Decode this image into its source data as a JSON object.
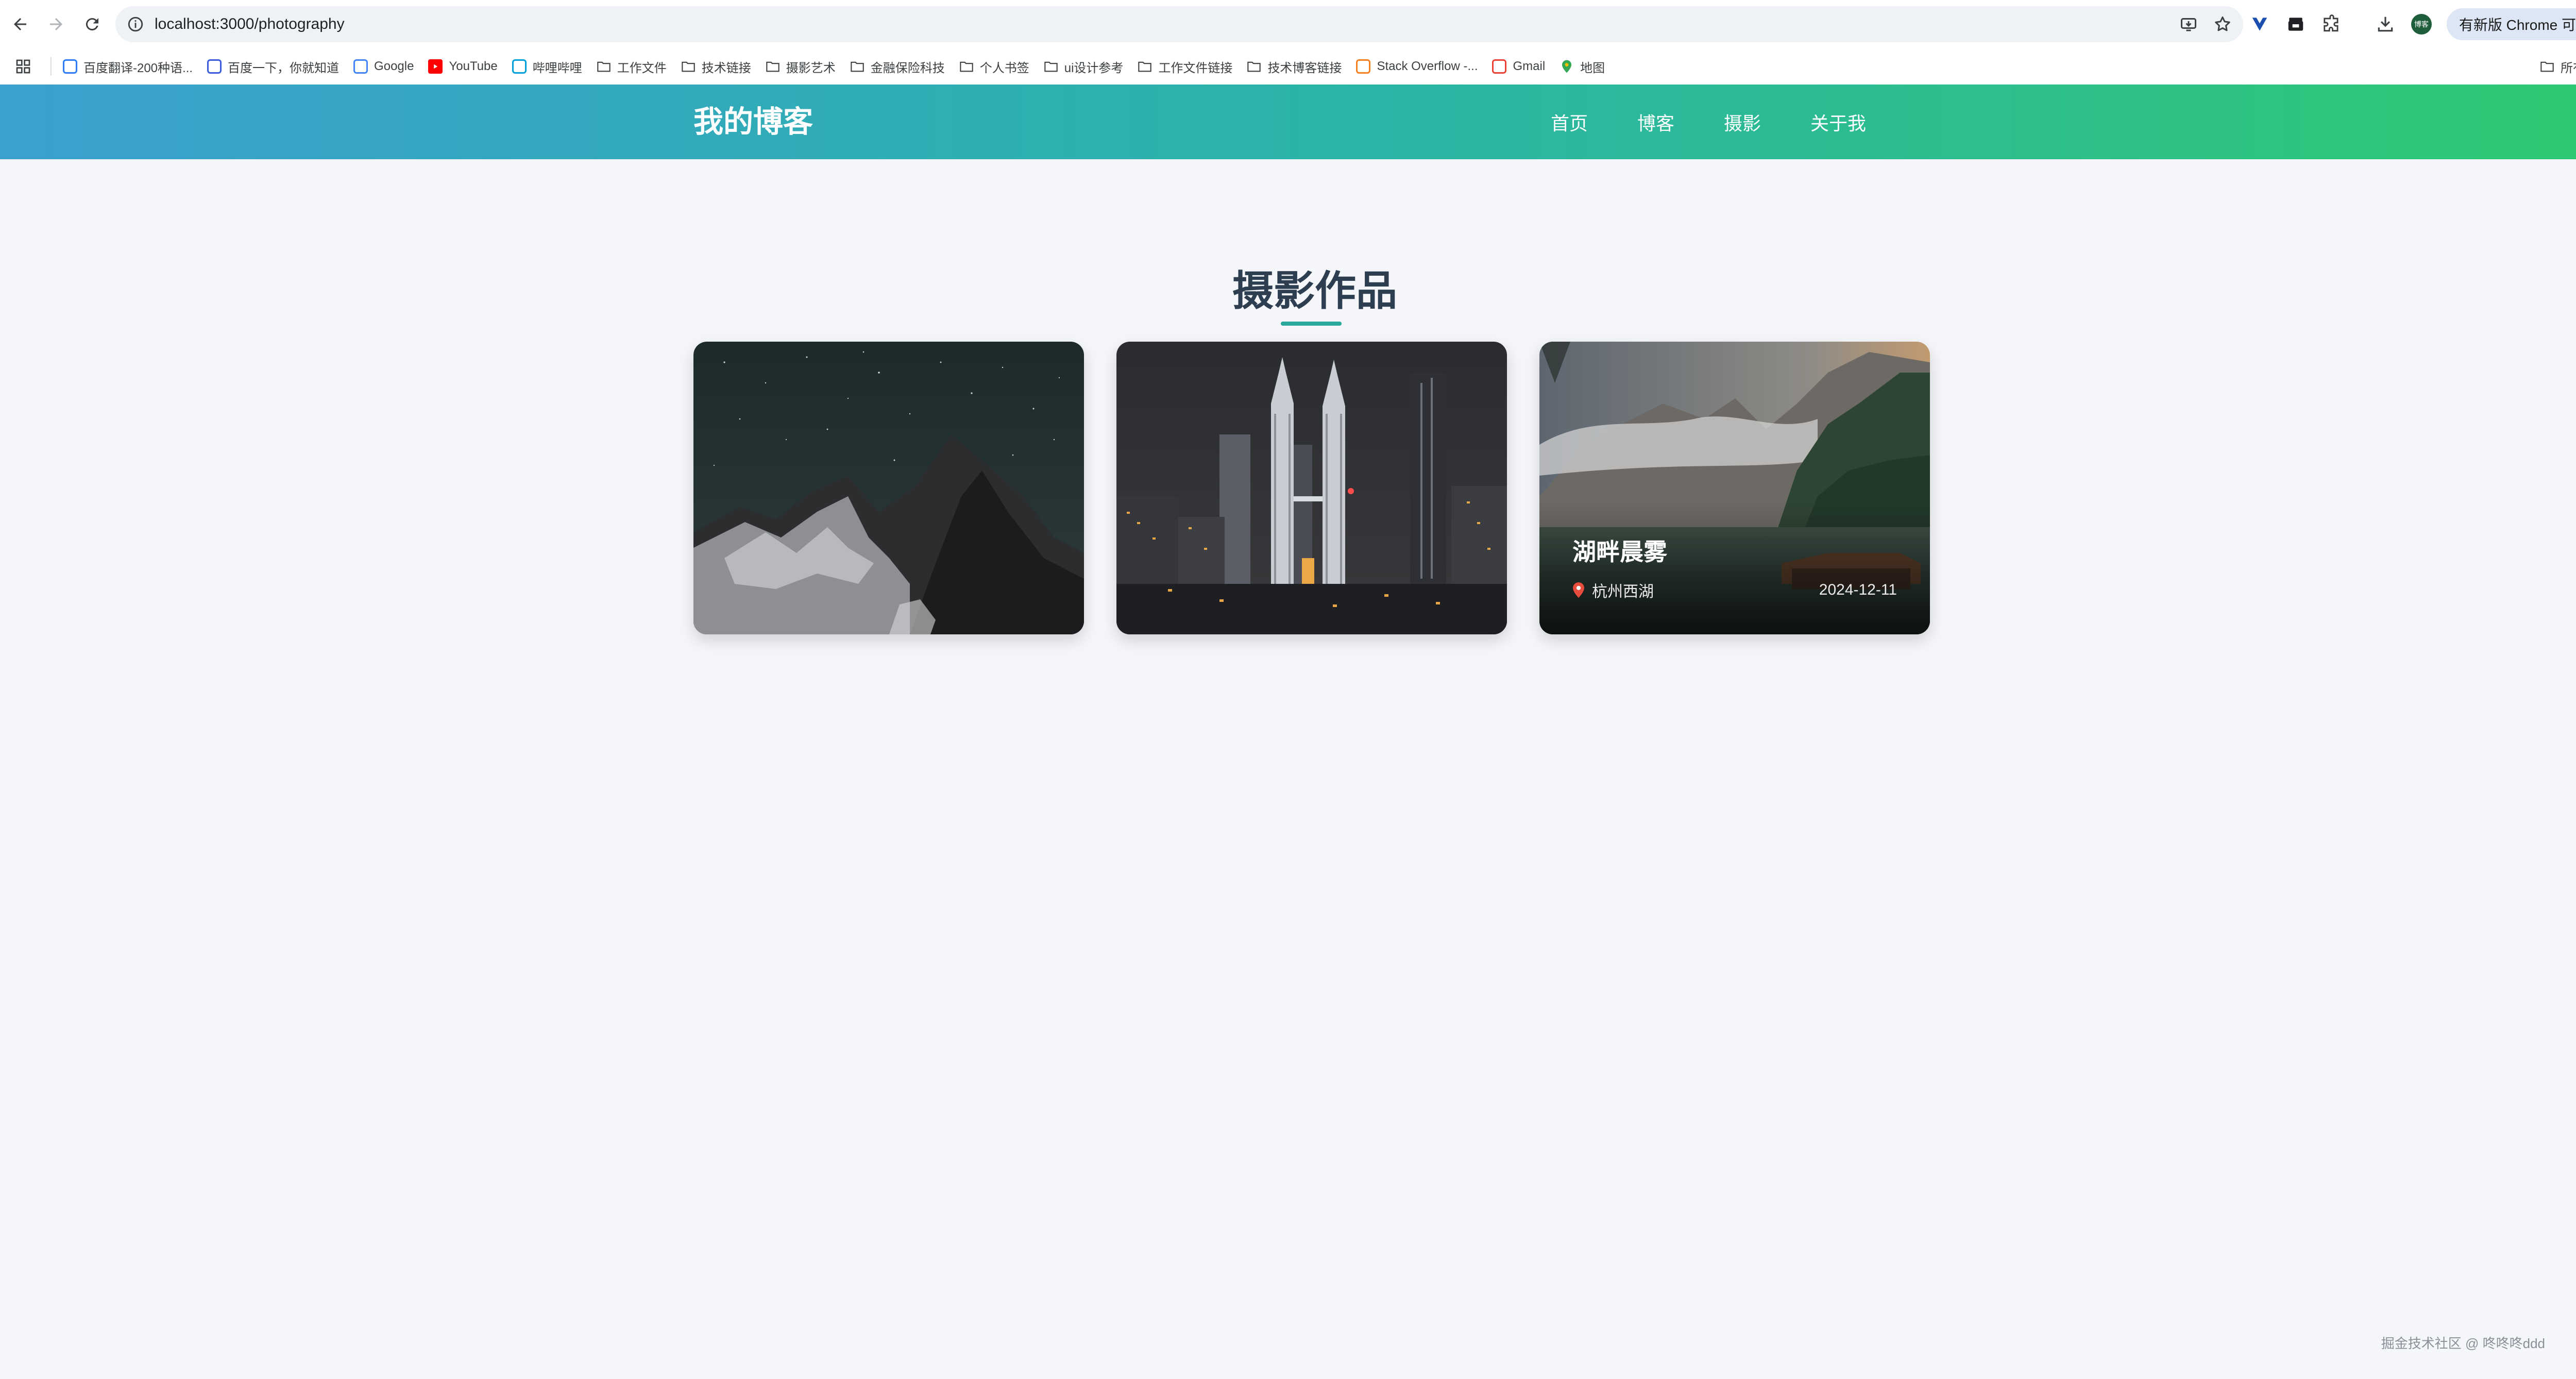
{
  "browser": {
    "url": "localhost:3000/photography",
    "update_label": "有新版 Chrome 可用",
    "profile_initials": "博客"
  },
  "bookmarks": [
    {
      "label": "百度翻译-200种语...",
      "icon": "baidu-translate-icon",
      "color": "#2f7df6"
    },
    {
      "label": "百度一下，你就知道",
      "icon": "baidu-paw-icon",
      "color": "#3b5bdb"
    },
    {
      "label": "Google",
      "icon": "google-icon",
      "color": "#4285f4"
    },
    {
      "label": "YouTube",
      "icon": "youtube-icon",
      "color": "#ff0000"
    },
    {
      "label": "哔哩哔哩",
      "icon": "bilibili-icon",
      "color": "#00a1d6"
    },
    {
      "label": "工作文件",
      "icon": "folder-icon"
    },
    {
      "label": "技术链接",
      "icon": "folder-icon"
    },
    {
      "label": "摄影艺术",
      "icon": "folder-icon"
    },
    {
      "label": "金融保险科技",
      "icon": "folder-icon"
    },
    {
      "label": "个人书签",
      "icon": "folder-icon"
    },
    {
      "label": "ui设计参考",
      "icon": "folder-icon"
    },
    {
      "label": "工作文件链接",
      "icon": "folder-icon"
    },
    {
      "label": "技术博客链接",
      "icon": "folder-icon"
    },
    {
      "label": "Stack Overflow -...",
      "icon": "stackoverflow-icon",
      "color": "#f48024"
    },
    {
      "label": "Gmail",
      "icon": "gmail-icon",
      "color": "#ea4335"
    },
    {
      "label": "地图",
      "icon": "maps-icon",
      "color": "#34a853"
    }
  ],
  "all_bookmarks_label": "所有书签",
  "site": {
    "title": "我的博客",
    "nav": [
      "首页",
      "博客",
      "摄影",
      "关于我"
    ]
  },
  "page": {
    "heading": "摄影作品"
  },
  "photos": [
    {
      "subject": "starry-mountain-night",
      "title": "",
      "location": "",
      "date": ""
    },
    {
      "subject": "city-twin-towers-night",
      "title": "",
      "location": "",
      "date": ""
    },
    {
      "subject": "lake-mountain-mist",
      "title": "湖畔晨雾",
      "location": "杭州西湖",
      "date": "2024-12-11"
    }
  ],
  "watermark": "掘金技术社区 @ 咚咚咚ddd",
  "colors": {
    "header_gradient_start": "#3aa0cf",
    "header_gradient_end": "#2ec971",
    "accent": "#2aa89a",
    "page_bg": "#f5f6f9"
  }
}
